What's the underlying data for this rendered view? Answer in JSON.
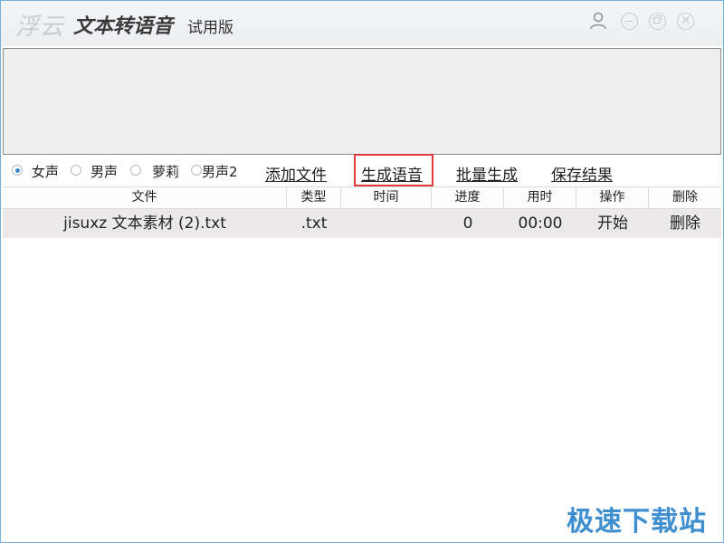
{
  "titlebar": {
    "brand": "浮云",
    "app_name": "文本转语音",
    "edition": "试用版"
  },
  "icons": {
    "user": "user-icon",
    "minimize": "minimize-icon",
    "maximize": "restore-icon",
    "close": "close-icon"
  },
  "voices": [
    {
      "label": "女声",
      "checked": true
    },
    {
      "label": "男声",
      "checked": false
    },
    {
      "label": "萝莉",
      "checked": false
    },
    {
      "label": "男声2",
      "checked": false
    }
  ],
  "actions": {
    "add_file": "添加文件",
    "generate": "生成语音",
    "batch": "批量生成",
    "save": "保存结果"
  },
  "table": {
    "headers": [
      "文件",
      "类型",
      "时间",
      "进度",
      "用时",
      "操作",
      "删除"
    ],
    "rows": [
      {
        "file": "jisuxz 文本素材 (2).txt",
        "type": ".txt",
        "time": "",
        "progress": "0",
        "elapsed": "00:00",
        "operation": "开始",
        "delete": "删除"
      }
    ]
  },
  "watermark": "极速下载站",
  "colors": {
    "accent": "#3b88c9",
    "highlight": "#e03a3a",
    "watermark": "#3f8fd0",
    "window_border": "#6fb2de"
  }
}
